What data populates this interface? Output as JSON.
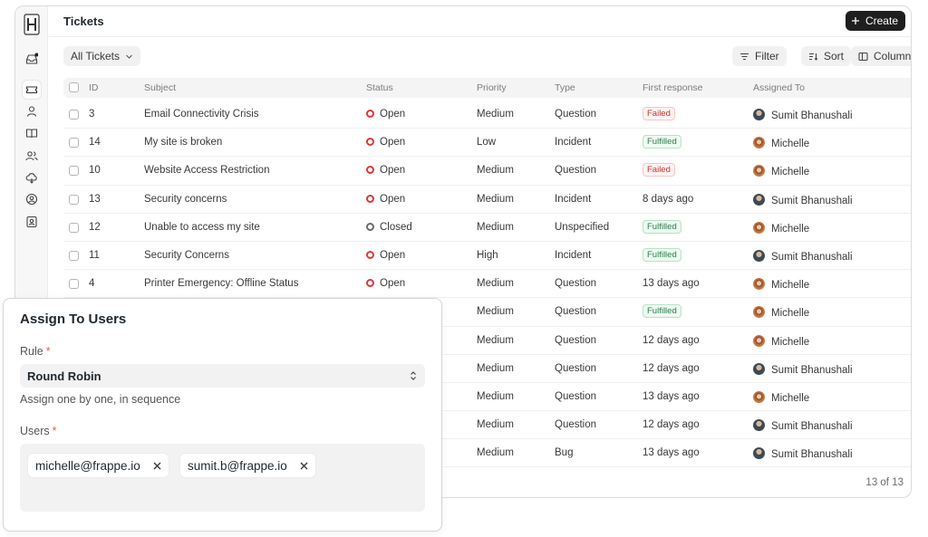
{
  "header": {
    "title": "Tickets",
    "create_label": "Create"
  },
  "toolbar": {
    "view_label": "All Tickets",
    "filter_label": "Filter",
    "sort_label": "Sort",
    "columns_label": "Columns"
  },
  "sidebar": {
    "icons": [
      "logo-icon",
      "inbox-icon",
      "ticket-icon",
      "user-icon",
      "book-icon",
      "users-icon",
      "cloud-icon",
      "user-circle-icon",
      "contact-icon"
    ]
  },
  "table": {
    "columns": [
      "ID",
      "Subject",
      "Status",
      "Priority",
      "Type",
      "First response",
      "Assigned To"
    ],
    "rows": [
      {
        "id": "3",
        "subject": "Email Connectivity Crisis",
        "status": "Open",
        "priority": "Medium",
        "type": "Question",
        "first_response": "Failed",
        "first_response_kind": "badge-failed",
        "assigned": "Sumit Bhanushali",
        "avatar": "sumit"
      },
      {
        "id": "14",
        "subject": "My site is broken",
        "status": "Open",
        "priority": "Low",
        "type": "Incident",
        "first_response": "Fulfilled",
        "first_response_kind": "badge-fulfilled",
        "assigned": "Michelle",
        "avatar": "michelle"
      },
      {
        "id": "10",
        "subject": "Website Access Restriction",
        "status": "Open",
        "priority": "Medium",
        "type": "Question",
        "first_response": "Failed",
        "first_response_kind": "badge-failed",
        "assigned": "Michelle",
        "avatar": "michelle"
      },
      {
        "id": "13",
        "subject": "Security concerns",
        "status": "Open",
        "priority": "Medium",
        "type": "Incident",
        "first_response": "8 days ago",
        "first_response_kind": "text",
        "assigned": "Sumit Bhanushali",
        "avatar": "sumit"
      },
      {
        "id": "12",
        "subject": "Unable to access my site",
        "status": "Closed",
        "priority": "Medium",
        "type": "Unspecified",
        "first_response": "Fulfilled",
        "first_response_kind": "badge-fulfilled",
        "assigned": "Michelle",
        "avatar": "michelle"
      },
      {
        "id": "11",
        "subject": "Security Concerns",
        "status": "Open",
        "priority": "High",
        "type": "Incident",
        "first_response": "Fulfilled",
        "first_response_kind": "badge-fulfilled",
        "assigned": "Sumit Bhanushali",
        "avatar": "sumit"
      },
      {
        "id": "4",
        "subject": "Printer Emergency: Offline Status",
        "status": "Open",
        "priority": "Medium",
        "type": "Question",
        "first_response": "13 days ago",
        "first_response_kind": "text",
        "assigned": "Michelle",
        "avatar": "michelle"
      },
      {
        "id": "",
        "subject": "",
        "status": "",
        "priority": "Medium",
        "type": "Question",
        "first_response": "Fulfilled",
        "first_response_kind": "badge-fulfilled",
        "assigned": "Michelle",
        "avatar": "michelle"
      },
      {
        "id": "",
        "subject": "",
        "status": "",
        "priority": "Medium",
        "type": "Question",
        "first_response": "12 days ago",
        "first_response_kind": "text",
        "assigned": "Michelle",
        "avatar": "michelle"
      },
      {
        "id": "",
        "subject": "",
        "status": "",
        "priority": "Medium",
        "type": "Question",
        "first_response": "12 days ago",
        "first_response_kind": "text",
        "assigned": "Sumit Bhanushali",
        "avatar": "sumit"
      },
      {
        "id": "",
        "subject": "",
        "status": "",
        "priority": "Medium",
        "type": "Question",
        "first_response": "13 days ago",
        "first_response_kind": "text",
        "assigned": "Michelle",
        "avatar": "michelle"
      },
      {
        "id": "",
        "subject": "",
        "status": "",
        "priority": "Medium",
        "type": "Question",
        "first_response": "12 days ago",
        "first_response_kind": "text",
        "assigned": "Sumit Bhanushali",
        "avatar": "sumit"
      },
      {
        "id": "",
        "subject": "",
        "status": "",
        "priority": "Medium",
        "type": "Bug",
        "first_response": "13 days ago",
        "first_response_kind": "text",
        "assigned": "Sumit Bhanushali",
        "avatar": "sumit"
      }
    ],
    "footer_count": "13 of 13"
  },
  "modal": {
    "title": "Assign To Users",
    "rule_label": "Rule",
    "rule_value": "Round Robin",
    "rule_help": "Assign one by one, in sequence",
    "users_label": "Users",
    "required_mark": "*",
    "users": [
      "michelle@frappe.io",
      "sumit.b@frappe.io"
    ]
  },
  "colors": {
    "open_status": "#e03636",
    "closed_status": "#6b6b6b",
    "failed": "#c0392b",
    "fulfilled": "#2e7d4f",
    "primary_button": "#1f1f1f"
  }
}
